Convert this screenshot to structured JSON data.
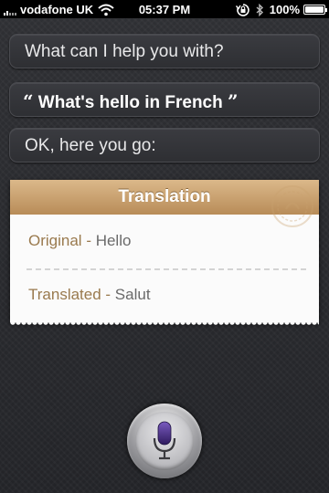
{
  "status_bar": {
    "carrier": "vodafone UK",
    "time": "05:37 PM",
    "battery_text": "100%",
    "battery_level": 1.0
  },
  "conversation": {
    "assistant_prompt": "What can I help you with?",
    "user_quote": "What's hello in French",
    "quote_open": "“",
    "quote_close": "”",
    "assistant_reply": "OK, here you go:"
  },
  "translation_card": {
    "title": "Translation",
    "original_label": "Original",
    "original_value": "Hello",
    "translated_label": "Translated",
    "translated_value": "Salut",
    "separator": " - "
  },
  "icons": {
    "signal": "signal-bars-icon",
    "wifi": "wifi-icon",
    "orientation_lock": "orientation-lock-icon",
    "bluetooth": "bluetooth-icon",
    "battery": "battery-icon",
    "microphone": "microphone-icon"
  },
  "colors": {
    "card_header": "#c9a26f",
    "card_label": "#9a7a4e",
    "mic_accent": "#4b2e86"
  }
}
